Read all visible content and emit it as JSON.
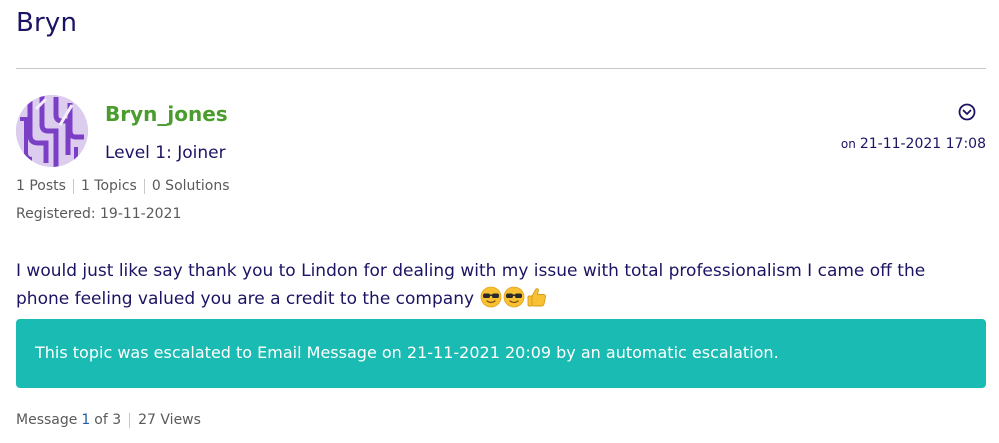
{
  "topic": {
    "title": "Bryn"
  },
  "author": {
    "name": "Bryn_jones",
    "rank": "Level 1: Joiner",
    "stats": {
      "posts": "1 Posts",
      "topics": "1 Topics",
      "solutions": "0 Solutions"
    },
    "registered": "Registered: 19-11-2021"
  },
  "post": {
    "date_prefix": "on",
    "date": "21-11-2021 17:08",
    "body": "I would just like say thank you to Lindon for dealing with my issue with total professionalism I came off the phone feeling valued you are a credit to the company",
    "emojis": [
      "sunglasses-emoji",
      "sunglasses-emoji",
      "thumbs-up-emoji"
    ]
  },
  "escalation": {
    "text": "This topic was escalated to Email Message on 21-11-2021 20:09 by an automatic escalation."
  },
  "footer": {
    "message_label": "Message",
    "message_current": "1",
    "message_total": "of 3",
    "views": "27 Views"
  },
  "colors": {
    "title": "#1b1464",
    "author_name": "#4a9c2d",
    "escalation_bg": "#1abbb2",
    "avatar": "#d9c9ec"
  }
}
